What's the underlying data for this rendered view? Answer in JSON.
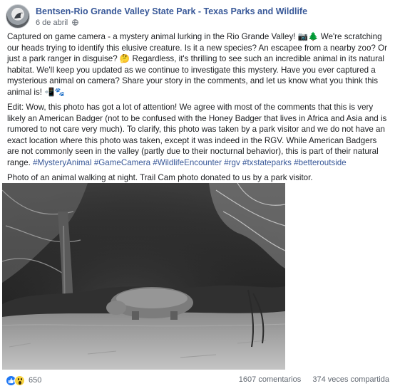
{
  "post": {
    "page_name": "Bentsen-Rio Grande Valley State Park - Texas Parks and Wildlife",
    "date": "6 de abril",
    "paragraph_1": "Captured on game camera - a mystery animal lurking in the Rio Grande Valley! 📷🌲 We're scratching our heads trying to identify this elusive creature. Is it a new species? An escapee from a nearby zoo? Or just a park ranger in disguise? 🤔 Regardless, it's thrilling to see such an incredible animal in its natural habitat. We'll keep you updated as we continue to investigate this mystery. Have you ever captured a mysterious animal on camera? Share your story in the comments, and let us know what you think this animal is! 📲🐾",
    "paragraph_2": "Edit: Wow, this photo has got a lot of attention! We agree with most of the comments that this is very likely an American Badger (not to be confused with the Honey Badger that lives in Africa and Asia and is rumored to not care very much). To clarify, this photo was taken by a park visitor and we do not have an exact location where this photo was taken, except it was indeed in the RGV. While American Badgers are not commonly seen in the valley (partly due to their nocturnal behavior), this is part of their natural range.",
    "hashtags": [
      "#MysteryAnimal",
      "#GameCamera",
      "#WildlifeEncounter",
      "#rgv",
      "#txstateparks",
      "#betteroutside"
    ],
    "photo_caption": "Photo of an animal walking at night. Trail Cam photo donated to us by a park visitor."
  },
  "footer": {
    "reaction_count": "650",
    "comments": "1607 comentarios",
    "shares": "374 veces compartida"
  },
  "icons": {
    "avatar": "page-avatar-icon",
    "globe": "globe-icon",
    "like": "like-reaction-icon",
    "wow": "wow-reaction-icon"
  },
  "colors": {
    "link": "#385898",
    "meta": "#606770",
    "like": "#2078f4",
    "wow": "#f7d23f"
  }
}
